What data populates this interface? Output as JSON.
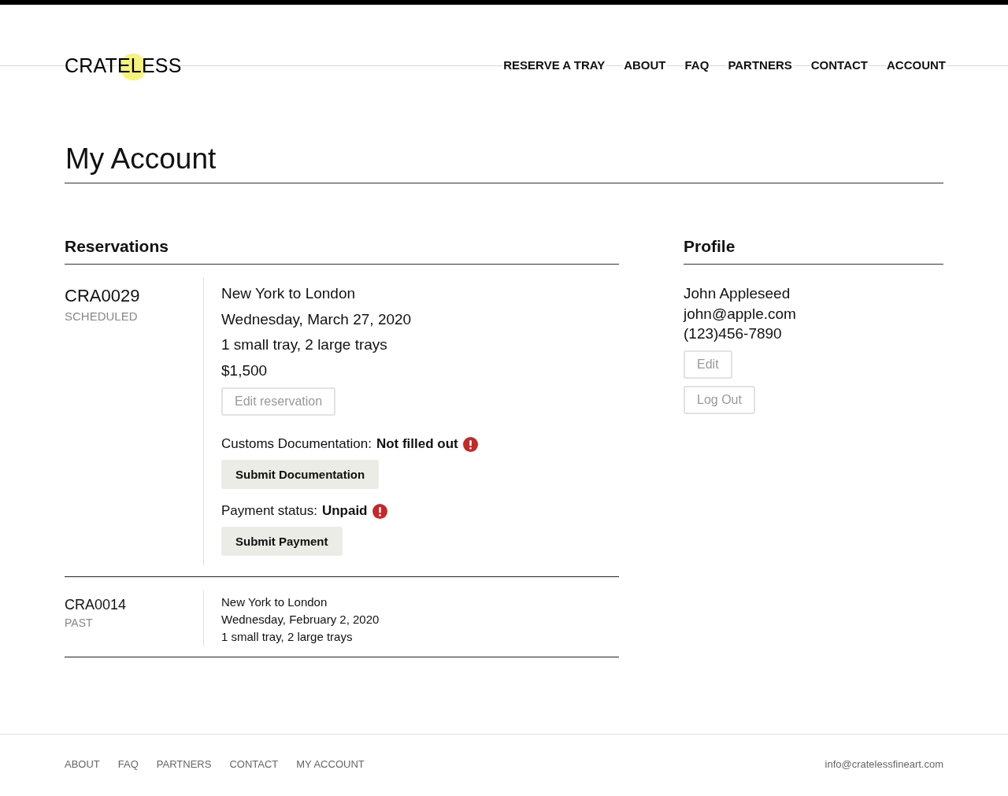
{
  "header": {
    "logo": "CRATELESS",
    "nav": [
      "RESERVE A TRAY",
      "ABOUT",
      "FAQ",
      "PARTNERS",
      "CONTACT",
      "ACCOUNT"
    ]
  },
  "page_title": "My Account",
  "reservations": {
    "heading": "Reservations",
    "items": [
      {
        "kind": "detailed",
        "id": "CRA0029",
        "status": "SCHEDULED",
        "lines": [
          "New York to London",
          "Wednesday, March 27, 2020",
          "1 small tray, 2 large trays",
          "$1,500"
        ],
        "edit_button": "Edit reservation",
        "checks": [
          {
            "label": "Customs Documentation:",
            "value": "Not filled out",
            "alert": true,
            "button": "Submit Documentation"
          },
          {
            "label": "Payment status:",
            "value": "Unpaid",
            "alert": true,
            "button": "Submit Payment"
          }
        ]
      },
      {
        "kind": "summary",
        "id": "CRA0014",
        "status": "PAST",
        "lines": [
          "New York to London",
          "Wednesday, February 2, 2020",
          "1 small tray, 2 large trays"
        ]
      }
    ]
  },
  "profile": {
    "heading": "Profile",
    "name": "John Appleseed",
    "email": "john@apple.com",
    "phone": "(123)456-7890",
    "buttons": [
      "Edit",
      "Log Out"
    ]
  },
  "footer": {
    "links": [
      "ABOUT",
      "FAQ",
      "PARTNERS",
      "CONTACT",
      "MY ACCOUNT"
    ],
    "email": "info@cratelessfineart.com"
  }
}
